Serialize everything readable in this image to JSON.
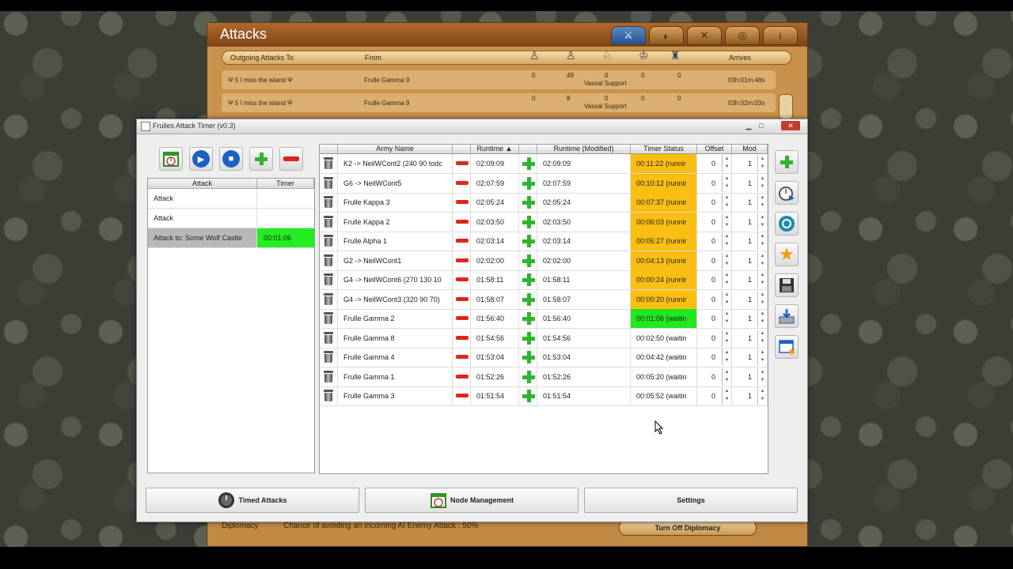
{
  "game": {
    "title": "Attacks",
    "tabs": [
      "⚔",
      "◐",
      "✕",
      "◎",
      "i"
    ],
    "column_headers": {
      "outgoing": "Outgoing Attacks To",
      "from": "From",
      "arrives": "Arrives"
    },
    "rows": [
      {
        "target": "Ψ 5 I miss the island Ψ",
        "from": "Frulle Gamma 9",
        "n1": "0",
        "n2": "49",
        "n3": "0",
        "n4": "0",
        "n5": "0",
        "note": "Vassal Support",
        "arrives": "03h:01m:48s"
      },
      {
        "target": "Ψ 5 I miss the island Ψ",
        "from": "Frulle Gamma 9",
        "n1": "0",
        "n2": "8",
        "n3": "0",
        "n4": "0",
        "n5": "0",
        "note": "Vassal Support",
        "arrives": "03h:02m:03s"
      }
    ],
    "bottom": {
      "label": "Diplomacy",
      "text": "Chance of avoiding an incoming AI Enemy Attack : 50%",
      "button": "Turn Off Diplomacy"
    }
  },
  "window": {
    "title": "Frulles Attack Timer (v0.3)",
    "min": "▁",
    "max": "□",
    "close": "✕"
  },
  "left_table": {
    "headers": {
      "attack": "Attack",
      "timer": "Timer"
    },
    "rows": [
      {
        "attack": "Attack",
        "timer": ""
      },
      {
        "attack": "Attack",
        "timer": ""
      },
      {
        "attack": "Attack to: Some Wolf Castle",
        "timer": "00:01:06"
      }
    ]
  },
  "table": {
    "headers": {
      "army": "Army Name",
      "runtime": "Runtime",
      "runtime_mod": "Runtime (Modified)",
      "status": "Timer Status",
      "offset": "Offset",
      "mod": "Mod"
    },
    "sort_indicator": "▲",
    "rows": [
      {
        "army": "K2 -> NeilWCont2 (240 90 todc",
        "runtime": "02:09:09",
        "modified": "02:09:09",
        "status": "00:11:22 (runnir",
        "state": "running",
        "offset": "0",
        "mod": "1"
      },
      {
        "army": "G6 -> NeilWCont5",
        "runtime": "02:07:59",
        "modified": "02:07:59",
        "status": "00:10:12 (runnir",
        "state": "running",
        "offset": "0",
        "mod": "1"
      },
      {
        "army": "Frulle Kappa 3",
        "runtime": "02:05:24",
        "modified": "02:05:24",
        "status": "00:07:37 (runnir",
        "state": "running",
        "offset": "0",
        "mod": "1"
      },
      {
        "army": "Frulle Kappa 2",
        "runtime": "02:03:50",
        "modified": "02:03:50",
        "status": "00:06:03 (runnir",
        "state": "running",
        "offset": "0",
        "mod": "1"
      },
      {
        "army": "Frulle Alpha 1",
        "runtime": "02:03:14",
        "modified": "02:03:14",
        "status": "00:05:27 (runnir",
        "state": "running",
        "offset": "0",
        "mod": "1"
      },
      {
        "army": "G2 -> NeilWCont1",
        "runtime": "02:02:00",
        "modified": "02:02:00",
        "status": "00:04:13 (runnir",
        "state": "running",
        "offset": "0",
        "mod": "1"
      },
      {
        "army": "G4 -> NeilWCont6 (270 130 10",
        "runtime": "01:58:11",
        "modified": "01:58:11",
        "status": "00:00:24 (runnir",
        "state": "running",
        "offset": "0",
        "mod": "1"
      },
      {
        "army": "G4 -> NeilWCont3 (320 90 70)",
        "runtime": "01:58:07",
        "modified": "01:58:07",
        "status": "00:00:20 (runnir",
        "state": "running",
        "offset": "0",
        "mod": "1"
      },
      {
        "army": "Frulle Gamma 2",
        "runtime": "01:56:40",
        "modified": "01:56:40",
        "status": "00:01:06 (waitin",
        "state": "waiting-active",
        "offset": "0",
        "mod": "1"
      },
      {
        "army": "Frulle Gamma 8",
        "runtime": "01:54:56",
        "modified": "01:54:56",
        "status": "00:02:50 (waitin",
        "state": "waiting",
        "offset": "0",
        "mod": "1"
      },
      {
        "army": "Frulle Gamma 4",
        "runtime": "01:53:04",
        "modified": "01:53:04",
        "status": "00:04:42 (waitin",
        "state": "waiting",
        "offset": "0",
        "mod": "1"
      },
      {
        "army": "Frulle Gamma 1",
        "runtime": "01:52:26",
        "modified": "01:52:26",
        "status": "00:05:20 (waitin",
        "state": "waiting",
        "offset": "0",
        "mod": "1"
      },
      {
        "army": "Frulle Gamma 3",
        "runtime": "01:51:54",
        "modified": "01:51:54",
        "status": "00:05:52 (waitin",
        "state": "waiting",
        "offset": "0",
        "mod": "1"
      }
    ]
  },
  "bottom_buttons": {
    "timed": "Timed Attacks",
    "node": "Node Management",
    "settings": "Settings"
  },
  "colors": {
    "running": "#fbbe12",
    "waiting_active": "#1fe81f",
    "selected_timer": "#22ee22",
    "game_header": "#9a5a24"
  }
}
